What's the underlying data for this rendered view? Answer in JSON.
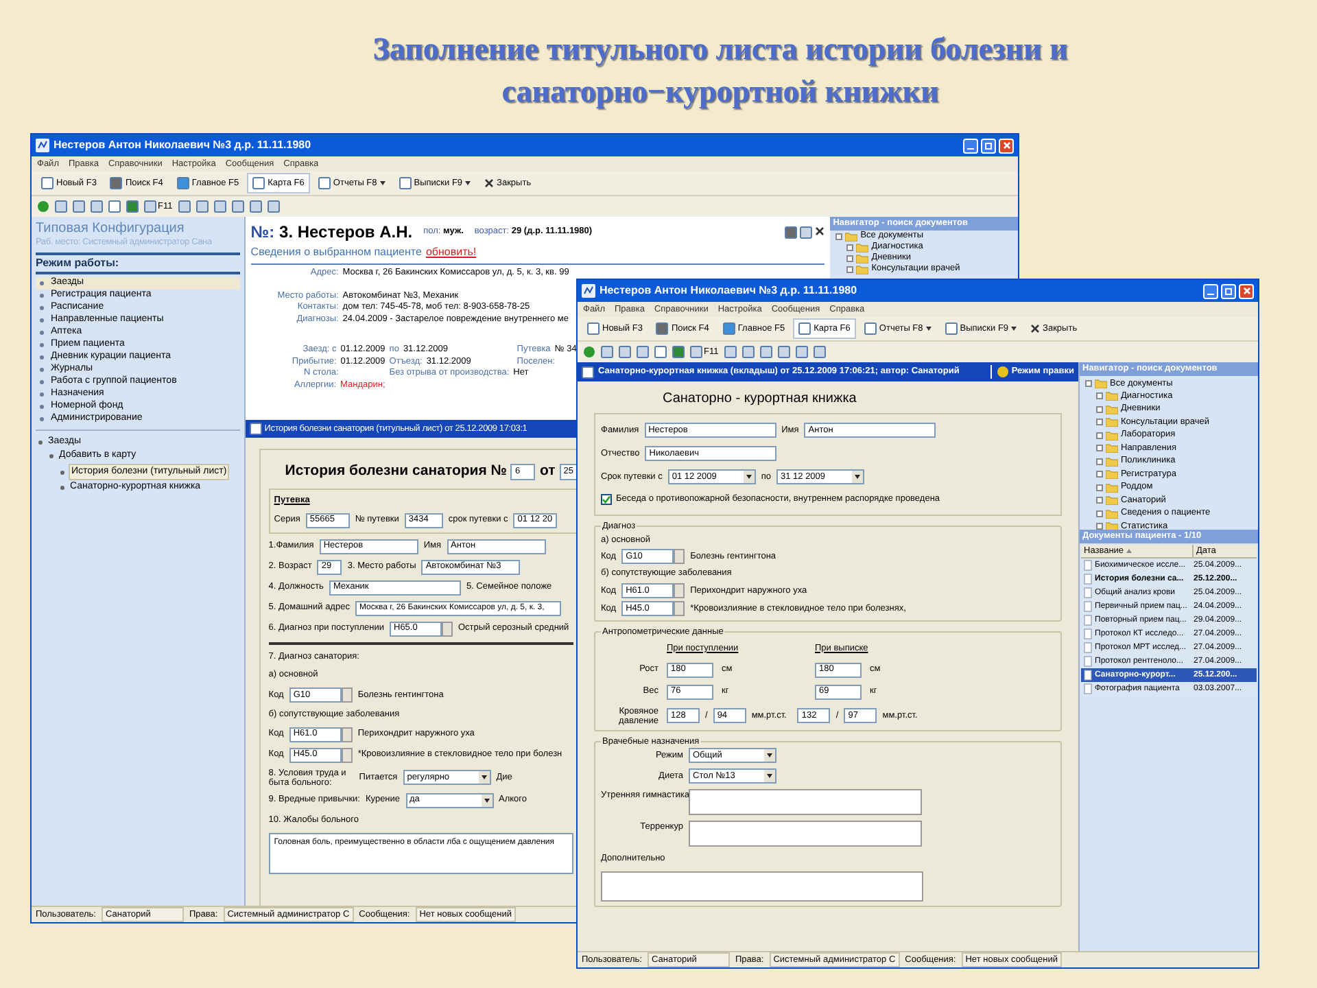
{
  "slide_title": [
    "Заполнение титульного листа истории болезни и",
    "санаторно−курортной книжки"
  ],
  "back_window": {
    "title": "Нестеров Антон Николаевич №3 д.р. 11.11.1980",
    "menu": [
      "Файл",
      "Правка",
      "Справочники",
      "Настройка",
      "Сообщения",
      "Справка"
    ],
    "toolbar": [
      {
        "label": "Новый F3",
        "dropdown": false,
        "selected": false
      },
      {
        "label": "Поиск F4",
        "dropdown": false,
        "selected": false
      },
      {
        "label": "Главное F5",
        "dropdown": false,
        "selected": false
      },
      {
        "label": "Карта F6",
        "dropdown": false,
        "selected": true
      },
      {
        "label": "Отчеты F8",
        "dropdown": true,
        "selected": false
      },
      {
        "label": "Выписки F9",
        "dropdown": true,
        "selected": false
      },
      {
        "label": "Закрыть",
        "dropdown": false,
        "selected": false
      }
    ],
    "toolbar2_label": "F11",
    "sidebar": {
      "title": "Типовая Конфигурация",
      "subtitle": "Раб. место: Системный администратор Сана",
      "mode_heading": "Режим работы:",
      "items": [
        {
          "label": "Заезды",
          "selected": true
        },
        {
          "label": "Регистрация пациента",
          "selected": false
        },
        {
          "label": "Расписание",
          "selected": false
        },
        {
          "label": "Направленные пациенты",
          "selected": false
        },
        {
          "label": "Аптека",
          "selected": false
        },
        {
          "label": "Прием пациента",
          "selected": false
        },
        {
          "label": "Дневник курации пациента",
          "selected": false
        },
        {
          "label": "Журналы",
          "selected": false
        },
        {
          "label": "Работа с группой пациентов",
          "selected": false
        },
        {
          "label": "Назначения",
          "selected": false
        },
        {
          "label": "Номерной фонд",
          "selected": false
        },
        {
          "label": "Администрирование",
          "selected": false
        }
      ],
      "tree": [
        {
          "label": "Заезды",
          "selected": false,
          "children": [
            {
              "label": "Добавить в карту",
              "selected": false,
              "children": [
                {
                  "label": "История болезни (титульный лист)",
                  "selected": true
                },
                {
                  "label": "Санаторно-курортная книжка",
                  "selected": false
                }
              ]
            }
          ]
        }
      ]
    },
    "patient": {
      "number_label": "№:",
      "name": "3. Нестеров А.Н.",
      "sex_label": "пол:",
      "sex": "муж.",
      "age_label": "возраст:",
      "age": "29 (д.р. 11.11.1980)",
      "section": "Сведения о выбранном пациенте",
      "refresh_link": "обновить!"
    },
    "info": [
      {
        "label": "Адрес:",
        "value": "Москва г, 26 Бакинских Комиссаров ул, д. 5, к. 3, кв. 99"
      },
      {
        "label": "Место работы:",
        "value": "Автокомбинат №3, Механик"
      },
      {
        "label": "Контакты:",
        "value": "дом тел: 745-45-78, моб тел: 8-903-658-78-25"
      },
      {
        "label": "Диагнозы:",
        "value": "24.04.2009 - Застарелое повреждение внутреннего ме"
      }
    ],
    "stay": [
      [
        {
          "label": "Заезд: с",
          "value": "01.12.2009"
        },
        {
          "label": "по",
          "value": "31.12.2009"
        },
        {
          "label": "Путевка",
          "value": "№ 34"
        }
      ],
      [
        {
          "label": "Прибытие:",
          "value": "01.12.2009"
        },
        {
          "label": "Отъезд:",
          "value": "31.12.2009"
        },
        {
          "label": "Поселен:"
        }
      ],
      [
        {
          "label": "N стола:"
        },
        {
          "label": "Без отрыва от производства:",
          "value": "Нет"
        }
      ],
      [
        {
          "label": "Аллергии:",
          "value": "Мандарин;",
          "alert": true
        }
      ]
    ],
    "doc_bar": "История болезни санатория (титульный лист) от 25.12.2009 17:03:1",
    "form": {
      "heading": "История болезни санатория №",
      "number": "6",
      "date_label": "от",
      "date": "25",
      "voucher": {
        "title": "Путевка",
        "series_label": "Серия",
        "series": "55665",
        "number_label": "№ путевки",
        "number": "3434",
        "period_label": "срок путевки с",
        "period_from": "01 12 20"
      },
      "lines": [
        {
          "parts": [
            {
              "kind": "label",
              "text": "1.Фамилия"
            },
            {
              "kind": "field",
              "value": "Нестеров"
            },
            {
              "kind": "label",
              "text": "Имя"
            },
            {
              "kind": "field",
              "value": "Антон"
            }
          ]
        },
        {
          "parts": [
            {
              "kind": "label",
              "text": "2. Возраст"
            },
            {
              "kind": "field_short",
              "value": "29"
            },
            {
              "kind": "label",
              "text": "3. Место работы"
            },
            {
              "kind": "field",
              "value": "Автокомбинат №3"
            }
          ]
        },
        {
          "parts": [
            {
              "kind": "label",
              "text": "4. Должность"
            },
            {
              "kind": "field_long",
              "value": "Механик"
            },
            {
              "kind": "label",
              "text": "5. Семейное положе"
            }
          ]
        },
        {
          "parts": [
            {
              "kind": "label",
              "text": "5. Домашний адрес"
            },
            {
              "kind": "field_wide",
              "value": "Москва г, 26 Бакинских Комиссаров ул, д. 5, к. 3,"
            }
          ]
        },
        {
          "parts": [
            {
              "kind": "label",
              "text": "6. Диагноз при поступлении"
            },
            {
              "kind": "code",
              "value": "H65.0"
            },
            {
              "kind": "label",
              "text": "Острый серозный средний"
            }
          ]
        },
        {
          "parts": [
            {
              "kind": "divider"
            }
          ]
        },
        {
          "parts": [
            {
              "kind": "label",
              "text": "7. Диагноз санатория:"
            }
          ]
        },
        {
          "parts": [
            {
              "kind": "label",
              "text": "а) основной"
            }
          ]
        },
        {
          "parts": [
            {
              "kind": "label",
              "text": "Код"
            },
            {
              "kind": "code",
              "value": "G10"
            },
            {
              "kind": "label",
              "text": "Болезнь гентингтона"
            }
          ]
        },
        {
          "parts": [
            {
              "kind": "label",
              "text": "б) сопутствующие заболевания"
            }
          ]
        },
        {
          "parts": [
            {
              "kind": "label",
              "text": "Код"
            },
            {
              "kind": "code",
              "value": "H61.0"
            },
            {
              "kind": "label",
              "text": "Перихондрит наружного уха"
            }
          ]
        },
        {
          "parts": [
            {
              "kind": "label",
              "text": "Код"
            },
            {
              "kind": "code",
              "value": "H45.0"
            },
            {
              "kind": "label",
              "text": "*Кровоизлияние в стекловидное тело при болезн"
            }
          ]
        },
        {
          "parts": [
            {
              "kind": "label_wrap",
              "text": "8. Условия труда и быта больного:"
            },
            {
              "kind": "label",
              "text": "Питается"
            },
            {
              "kind": "select",
              "value": "регулярно"
            },
            {
              "kind": "label",
              "text": "Дие"
            }
          ]
        },
        {
          "parts": [
            {
              "kind": "label",
              "text": "9. Вредные привычки:"
            },
            {
              "kind": "label",
              "text": "Курение"
            },
            {
              "kind": "select",
              "value": "да"
            },
            {
              "kind": "label",
              "text": "Алкого"
            }
          ]
        },
        {
          "parts": [
            {
              "kind": "label",
              "text": "10. Жалобы больного"
            }
          ]
        },
        {
          "parts": [
            {
              "kind": "textarea",
              "value": "Головная боль, преимущественно в области лба с ощущением давления"
            }
          ]
        }
      ]
    },
    "navigator": {
      "title": "Навигатор - поиск документов",
      "tree": [
        {
          "label": "Все документы",
          "children": [
            {
              "label": "Диагностика"
            },
            {
              "label": "Дневники"
            },
            {
              "label": "Консультации врачей"
            }
          ]
        }
      ]
    },
    "status": [
      {
        "label": "Пользователь:",
        "value": "Санаторий"
      },
      {
        "label": "Права:",
        "value": "Системный администратор С"
      },
      {
        "label": "Сообщения:",
        "value": "Нет новых сообщений"
      }
    ]
  },
  "front_window": {
    "title": "Нестеров Антон Николаевич №3 д.р. 11.11.1980",
    "menu": [
      "Файл",
      "Правка",
      "Справочники",
      "Настройка",
      "Сообщения",
      "Справка"
    ],
    "toolbar": [
      {
        "label": "Новый F3",
        "dropdown": false,
        "selected": false
      },
      {
        "label": "Поиск F4",
        "dropdown": false,
        "selected": false
      },
      {
        "label": "Главное F5",
        "dropdown": false,
        "selected": false
      },
      {
        "label": "Карта F6",
        "dropdown": false,
        "selected": true
      },
      {
        "label": "Отчеты F8",
        "dropdown": true,
        "selected": false
      },
      {
        "label": "Выписки F9",
        "dropdown": true,
        "selected": false
      },
      {
        "label": "Закрыть",
        "dropdown": false,
        "selected": false
      }
    ],
    "toolbar2_label": "F11",
    "doc_bar": {
      "text": "Санаторно-курортная книжка (вкладыш) от 25.12.2009 17:06:21; автор: Санаторий",
      "mode": "Режим правки"
    },
    "heading": "Санаторно - курортная книжка",
    "personal": [
      {
        "parts": [
          {
            "kind": "label",
            "text": "Фамилия"
          },
          {
            "kind": "field_long",
            "value": "Нестеров"
          },
          {
            "kind": "label",
            "text": "Имя"
          },
          {
            "kind": "field_long",
            "value": "Антон"
          }
        ]
      },
      {
        "parts": [
          {
            "kind": "label",
            "text": "Отчество"
          },
          {
            "kind": "field_long",
            "value": "Николаевич"
          }
        ]
      },
      {
        "parts": [
          {
            "kind": "label",
            "text": "Срок путевки с"
          },
          {
            "kind": "select",
            "value": "01 12 2009"
          },
          {
            "kind": "label",
            "text": "по"
          },
          {
            "kind": "select",
            "value": "31 12 2009"
          }
        ]
      },
      {
        "parts": [
          {
            "kind": "checkbox",
            "checked": true,
            "text": "Беседа о противопожарной безопасности, внутреннем распорядке проведена"
          }
        ]
      }
    ],
    "diagnosis": {
      "legend": "Диагноз",
      "lines": [
        {
          "parts": [
            {
              "kind": "label",
              "text": "а) основной"
            }
          ]
        },
        {
          "parts": [
            {
              "kind": "label",
              "text": "Код"
            },
            {
              "kind": "code",
              "value": "G10"
            },
            {
              "kind": "label",
              "text": "Болезнь гентингтона"
            }
          ]
        },
        {
          "parts": [
            {
              "kind": "label",
              "text": "б) сопутствующие заболевания"
            }
          ]
        },
        {
          "parts": [
            {
              "kind": "label",
              "text": "Код"
            },
            {
              "kind": "code",
              "value": "H61.0"
            },
            {
              "kind": "label",
              "text": "Перихондрит наружного уха"
            }
          ]
        },
        {
          "parts": [
            {
              "kind": "label",
              "text": "Код"
            },
            {
              "kind": "code",
              "value": "H45.0"
            },
            {
              "kind": "label",
              "text": "*Кровоизлияние в стекловидное тело при болезнях,"
            }
          ]
        }
      ]
    },
    "anthropometry": {
      "legend": "Антропометрические данные",
      "admission": "При поступлении",
      "discharge": "При выписке",
      "rows": [
        {
          "label": "Рост",
          "in": "180",
          "in_unit": "см",
          "out": "180",
          "out_unit": "см"
        },
        {
          "label": "Вес",
          "in": "76",
          "in_unit": "кг",
          "out": "69",
          "out_unit": "кг"
        }
      ],
      "pressure": {
        "label": "Кровяное давление",
        "in_sys": "128",
        "in_sep": "/",
        "in_dia": "94",
        "in_unit": "мм.рт.ст.",
        "out_sys": "132",
        "out_sep": "/",
        "out_dia": "97",
        "out_unit": "мм.рт.ст."
      }
    },
    "prescriptions": {
      "legend": "Врачебные назначения",
      "selects": [
        {
          "label": "Режим",
          "value": "Общий"
        },
        {
          "label": "Диета",
          "value": "Стол №13"
        }
      ],
      "notes": [
        {
          "label": "Утренняя гимнастика"
        },
        {
          "label": "Терренкур"
        }
      ],
      "extra": "Дополнительно"
    },
    "navigator": {
      "title": "Навигатор - поиск документов",
      "tree": [
        {
          "label": "Все документы",
          "children": [
            {
              "label": "Диагностика"
            },
            {
              "label": "Дневники"
            },
            {
              "label": "Консультации врачей"
            },
            {
              "label": "Лаборатория"
            },
            {
              "label": "Направления"
            },
            {
              "label": "Поликлиника"
            },
            {
              "label": "Регистратура"
            },
            {
              "label": "Роддом"
            },
            {
              "label": "Санаторий"
            },
            {
              "label": "Сведения о пациенте"
            },
            {
              "label": "Статистика"
            }
          ]
        }
      ]
    },
    "documents": {
      "title": "Документы пациента - 1/10",
      "columns": [
        "Название",
        "Дата"
      ],
      "rows": [
        {
          "name": "Биохимическое иссле...",
          "date": "25.04.2009...",
          "bold": false,
          "selected": false
        },
        {
          "name": "История болезни са...",
          "date": "25.12.200...",
          "bold": true,
          "selected": false
        },
        {
          "name": "Общий анализ крови",
          "date": "25.04.2009...",
          "bold": false,
          "selected": false
        },
        {
          "name": "Первичный прием пац...",
          "date": "24.04.2009...",
          "bold": false,
          "selected": false
        },
        {
          "name": "Повторный прием пац...",
          "date": "29.04.2009...",
          "bold": false,
          "selected": false
        },
        {
          "name": "Протокол КТ исследо...",
          "date": "27.04.2009...",
          "bold": false,
          "selected": false
        },
        {
          "name": "Протокол МРТ исслед...",
          "date": "27.04.2009...",
          "bold": false,
          "selected": false
        },
        {
          "name": "Протокол рентгеноло...",
          "date": "27.04.2009...",
          "bold": false,
          "selected": false
        },
        {
          "name": "Санаторно-курорт...",
          "date": "25.12.200...",
          "bold": true,
          "selected": true
        },
        {
          "name": "Фотография пациента",
          "date": "03.03.2007...",
          "bold": false,
          "selected": false
        }
      ]
    },
    "status": [
      {
        "label": "Пользователь:",
        "value": "Санаторий"
      },
      {
        "label": "Права:",
        "value": "Системный администратор С"
      },
      {
        "label": "Сообщения:",
        "value": "Нет новых сообщений"
      }
    ]
  }
}
